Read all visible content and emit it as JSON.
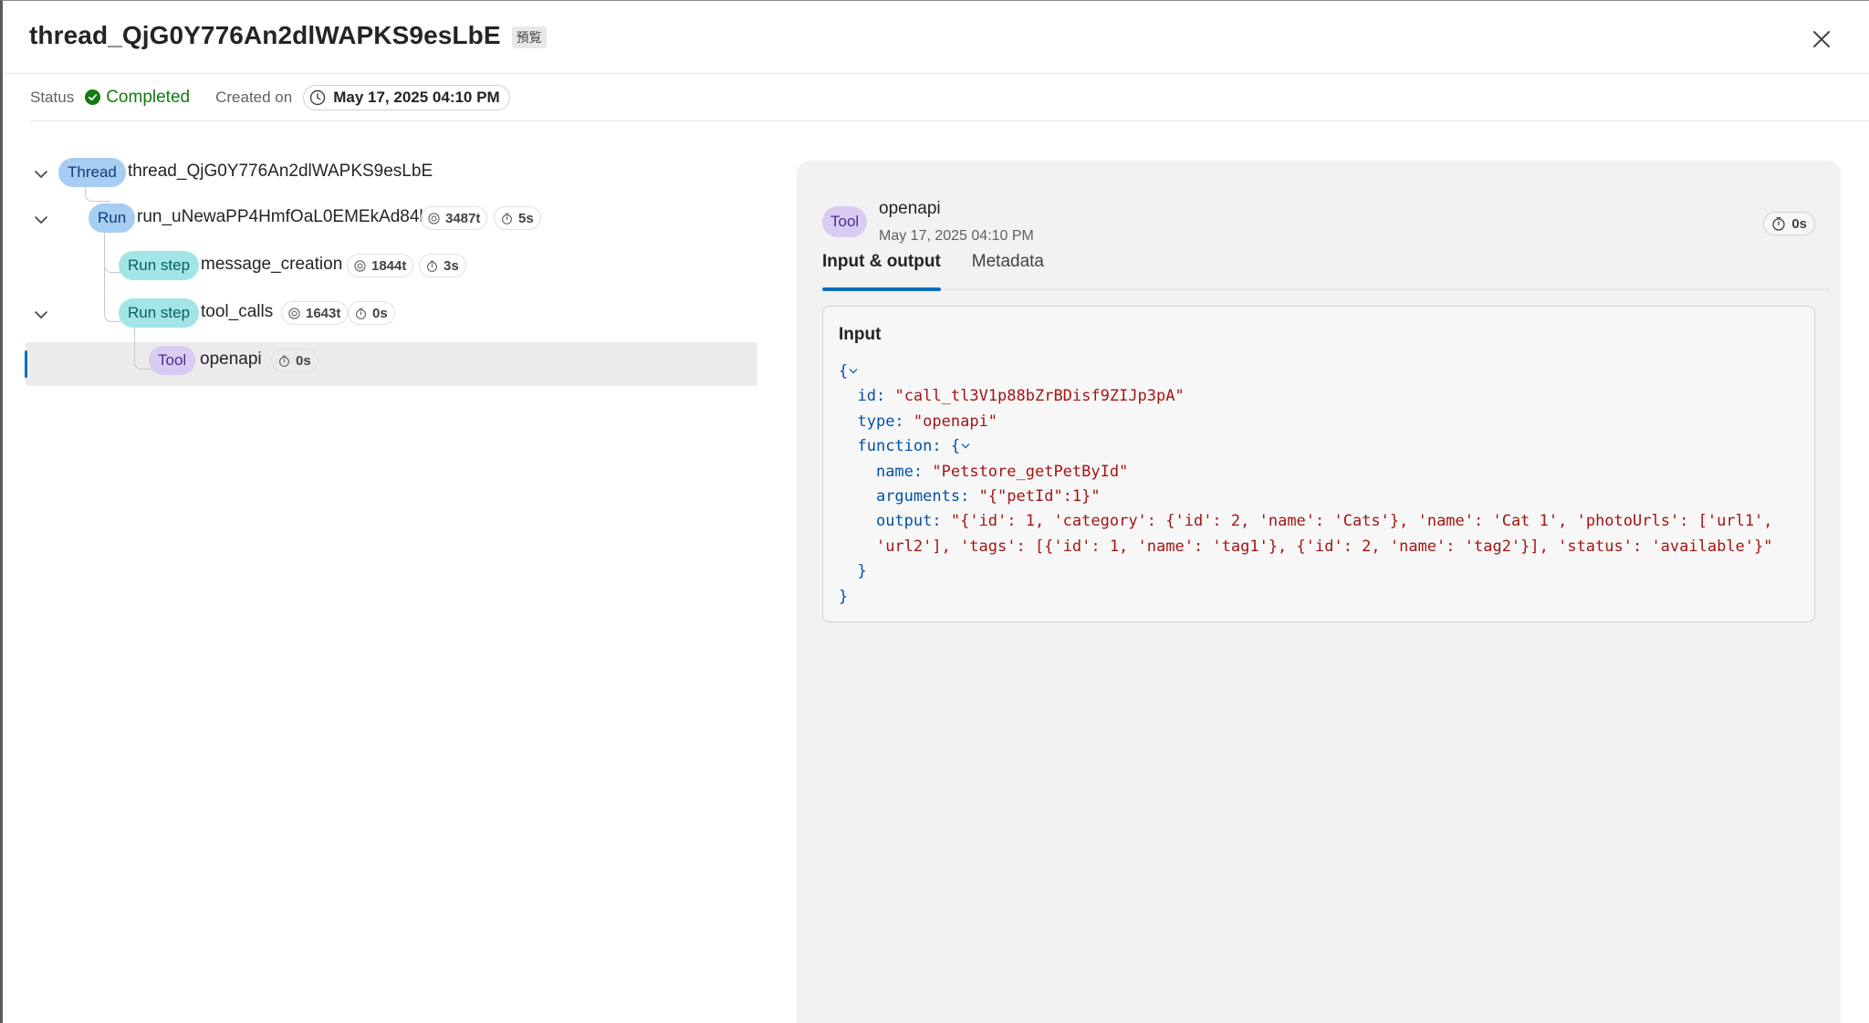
{
  "header": {
    "title": "thread_QjG0Y776An2dlWAPKS9esLbE",
    "preview_badge": "預覧"
  },
  "status_row": {
    "status_label": "Status",
    "status_value": "Completed",
    "created_label": "Created on",
    "created_value": "May 17, 2025 04:10 PM"
  },
  "tree": {
    "thread": {
      "pill": "Thread",
      "label": "thread_QjG0Y776An2dlWAPKS9esLbE"
    },
    "run": {
      "pill": "Run",
      "label": "run_uNewaPP4HmfOaL0EMEkAd84l",
      "tokens": "3487t",
      "duration": "5s"
    },
    "step1": {
      "pill": "Run step",
      "label": "message_creation",
      "tokens": "1844t",
      "duration": "3s"
    },
    "step2": {
      "pill": "Run step",
      "label": "tool_calls",
      "tokens": "1643t",
      "duration": "0s"
    },
    "tool": {
      "pill": "Tool",
      "label": "openapi",
      "duration": "0s"
    }
  },
  "detail": {
    "pill": "Tool",
    "name": "openapi",
    "date": "May 17, 2025 04:10 PM",
    "duration": "0s",
    "tabs": [
      {
        "label": "Input & output",
        "active": true
      },
      {
        "label": "Metadata",
        "active": false
      }
    ],
    "input_title": "Input",
    "json": {
      "open_brace": "{",
      "id_key": "id:",
      "id_val": "\"call_tl3V1p88bZrBDisf9ZIJp3pA\"",
      "type_key": "type:",
      "type_val": "\"openapi\"",
      "function_key": "function:",
      "function_open": "{",
      "name_key": "name:",
      "name_val": "\"Petstore_getPetById\"",
      "arguments_key": "arguments:",
      "arguments_val": "\"{\"petId\":1}\"",
      "output_key": "output:",
      "output_val_line1": "\"{'id': 1, 'category': {'id': 2, 'name': 'Cats'}, 'name': 'Cat 1', 'photoUrls': ['url1',",
      "output_val_line2": "'url2'], 'tags': [{'id': 1, 'name': 'tag1'}, {'id': 2, 'name': 'tag2'}], 'status': 'available'}\"",
      "function_close": "}",
      "close_brace": "}"
    }
  },
  "colors": {
    "accent": "#0f6cbd",
    "success": "#107c10",
    "thread_pill": "#a7cdf2",
    "step_pill": "#a2e5e6",
    "tool_pill": "#d9ccf3"
  }
}
